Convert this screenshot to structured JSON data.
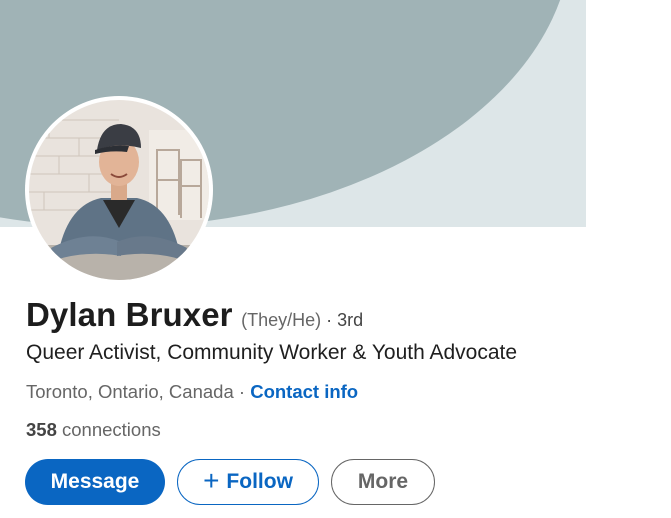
{
  "profile": {
    "name": "Dylan Bruxer",
    "pronouns": "(They/He)",
    "degree_sep": " · ",
    "degree": "3rd",
    "headline": "Queer Activist, Community Worker & Youth Advocate",
    "location": "Toronto, Ontario, Canada",
    "location_sep": " · ",
    "contact_label": "Contact info",
    "connections_count": "358",
    "connections_label": " connections"
  },
  "actions": {
    "message_label": "Message",
    "follow_icon": "+",
    "follow_label": "Follow",
    "more_label": "More"
  },
  "colors": {
    "accent": "#0a66c2",
    "cover_bg": "#dde6e8",
    "cover_arc": "#a0b3b6"
  },
  "icons": {
    "follow_icon": "plus-icon"
  }
}
